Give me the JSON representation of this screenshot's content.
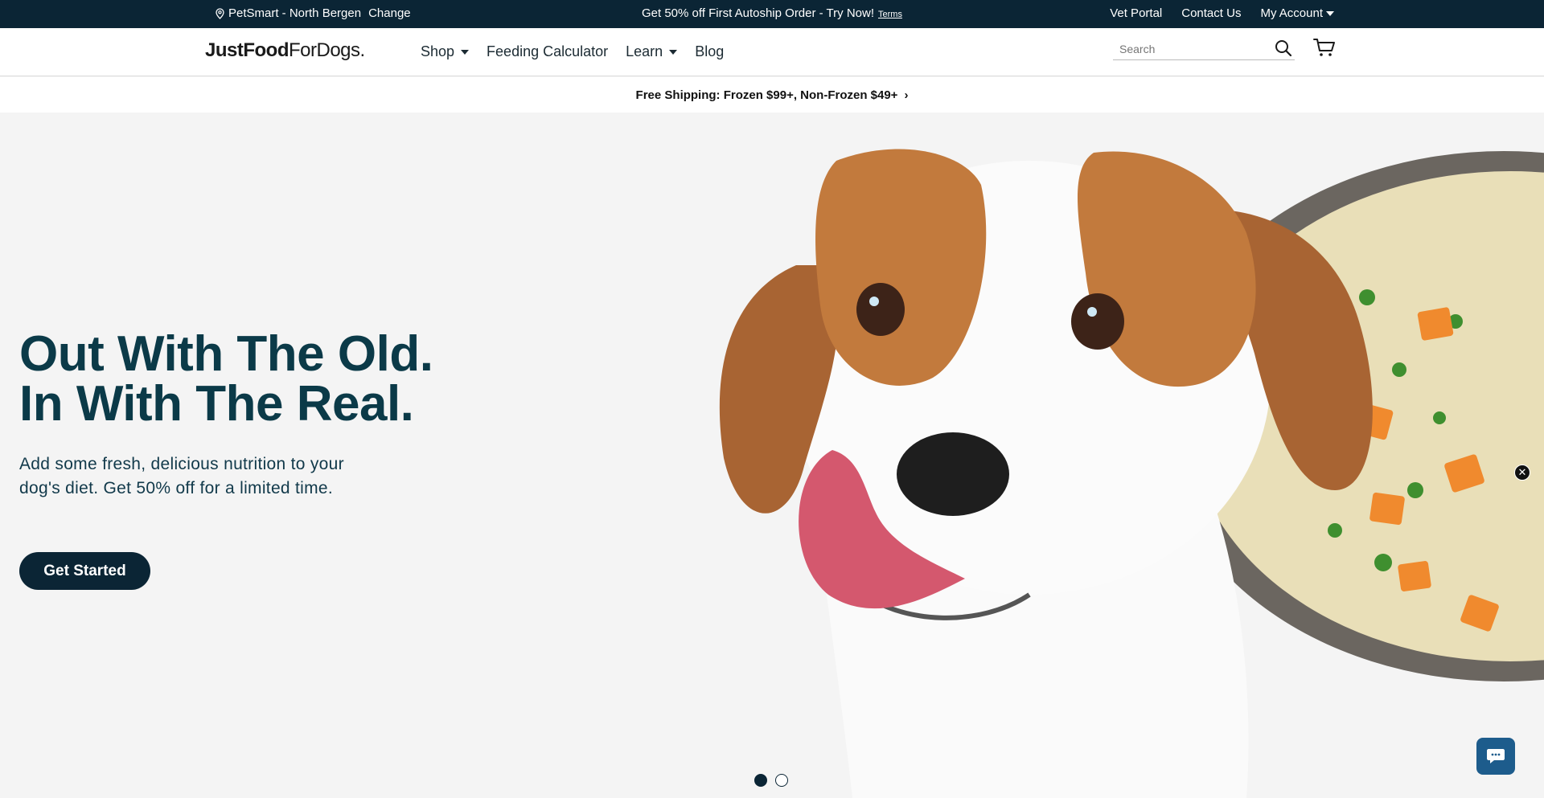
{
  "topbar": {
    "location": "PetSmart - North Bergen",
    "change_label": "Change",
    "promo_text": "Get 50% off First Autoship Order - Try Now!",
    "terms_label": "Terms",
    "vet_portal": "Vet Portal",
    "contact_us": "Contact Us",
    "my_account": "My Account"
  },
  "header": {
    "logo_bold": "JustFood",
    "logo_thin": "ForDogs",
    "logo_dot": ".",
    "nav": {
      "shop": "Shop",
      "calculator": "Feeding Calculator",
      "learn": "Learn",
      "blog": "Blog"
    },
    "search_placeholder": "Search"
  },
  "shipbar": {
    "text": "Free Shipping: Frozen $99+, Non-Frozen $49+",
    "chevron": "›"
  },
  "hero": {
    "headline_1": "Out With The Old.",
    "headline_2": "In With The Real.",
    "subtext": "Add some fresh, delicious nutrition to your dog's diet. Get 50% off for a limited time.",
    "cta": "Get Started",
    "slides_count": 2,
    "active_slide": 1
  },
  "icons": {
    "location": "location-pin-icon",
    "search": "search-icon",
    "cart": "cart-icon",
    "close": "close-icon",
    "chat": "chat-icon"
  },
  "colors": {
    "topbar_bg": "#0b2535",
    "headline": "#0b3a48",
    "cta_bg": "#0b2535",
    "chat_bg": "#1d5c8c"
  }
}
